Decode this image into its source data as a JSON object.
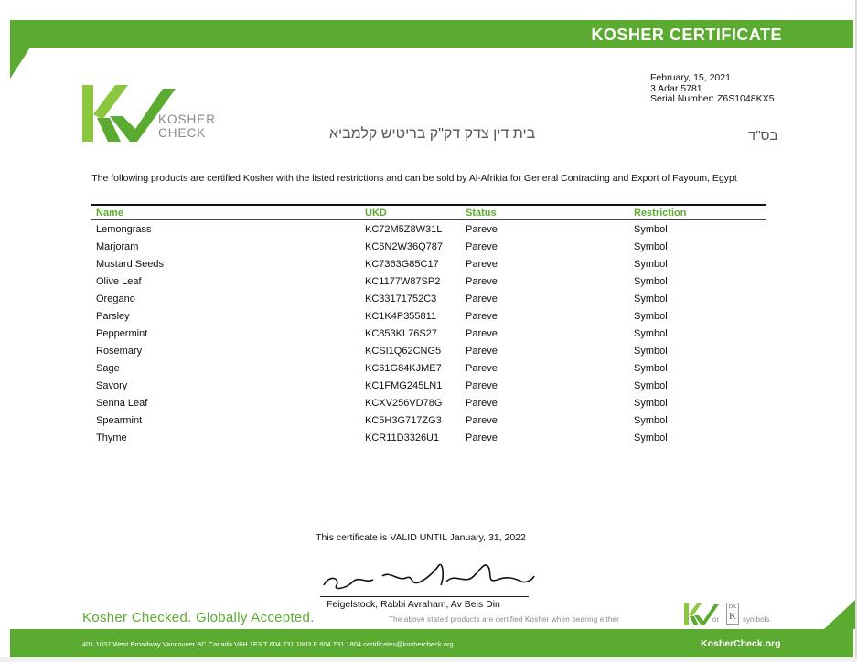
{
  "certificate": {
    "header_title": "KOSHER CERTIFICATE",
    "logo_word_1": "KOSHER",
    "logo_word_2": "CHECK",
    "hebrew_court": "בית דין צדק דק\"ק בריטיש קלמביא",
    "hebrew_bsd": "בס\"ד",
    "date": "February, 15, 2021",
    "hebrew_date": "3 Adar 5781",
    "serial_label": "Serial Number:",
    "serial_number": "Z6S1048KX5",
    "intro": "The following products are certified Kosher with the listed restrictions and can be sold by Al-Afrikia for General Contracting and Export of Fayoum, Egypt",
    "valid_until": "This certificate is VALID UNTIL January, 31, 2022",
    "signature": "אברהם פייגעלשטאק",
    "signer": "Feigelstock, Rabbi Avraham, Av Beis Din"
  },
  "table": {
    "headers": {
      "name": "Name",
      "ukd": "UKD",
      "status": "Status",
      "restriction": "Restriction"
    },
    "rows": [
      {
        "name": "Lemongrass",
        "ukd": "KC72M5Z8W31L",
        "status": "Pareve",
        "restriction": "Symbol"
      },
      {
        "name": "Marjoram",
        "ukd": "KC6N2W36Q787",
        "status": "Pareve",
        "restriction": "Symbol"
      },
      {
        "name": "Mustard Seeds",
        "ukd": "KC7363G85C17",
        "status": "Pareve",
        "restriction": "Symbol"
      },
      {
        "name": "Olive Leaf",
        "ukd": "KC1177W87SP2",
        "status": "Pareve",
        "restriction": "Symbol"
      },
      {
        "name": "Oregano",
        "ukd": "KC33171752C3",
        "status": "Pareve",
        "restriction": "Symbol"
      },
      {
        "name": "Parsley",
        "ukd": "KC1K4P355811",
        "status": "Pareve",
        "restriction": "Symbol"
      },
      {
        "name": "Peppermint",
        "ukd": "KC853KL76S27",
        "status": "Pareve",
        "restriction": "Symbol"
      },
      {
        "name": "Rosemary",
        "ukd": "KCSI1Q62CNG5",
        "status": "Pareve",
        "restriction": "Symbol"
      },
      {
        "name": "Sage",
        "ukd": "KC61G84KJME7",
        "status": "Pareve",
        "restriction": "Symbol"
      },
      {
        "name": "Savory",
        "ukd": "KC1FMG245LN1",
        "status": "Pareve",
        "restriction": "Symbol"
      },
      {
        "name": "Senna Leaf",
        "ukd": "KCXV256VD78G",
        "status": "Pareve",
        "restriction": "Symbol"
      },
      {
        "name": "Spearmint",
        "ukd": "KC5H3G717ZG3",
        "status": "Pareve",
        "restriction": "Symbol"
      },
      {
        "name": "Thyme",
        "ukd": "KCR11D3326U1",
        "status": "Pareve",
        "restriction": "Symbol"
      }
    ]
  },
  "footer": {
    "tagline": "Kosher Checked. Globally Accepted.",
    "fine_print": "The above stated products are certified Kosher when bearing either",
    "or_text": "or",
    "dk_top": "DK",
    "dk_letter": "K",
    "symbols_text": "symbols.",
    "contact": "401.1037 West Broadway  Vancouver BC  Canada V6H 1E3  T 604.731.1803  F 604.731.1804  certificates@koshercheck.org",
    "website": "KosherCheck.org"
  },
  "colors": {
    "brand_green": "#5bab30",
    "logo_light_green": "#8dc63f",
    "logo_dark_green": "#5bab30"
  },
  "icons": [
    "koshercheck-logo-icon",
    "koshercheck-small-logo-icon",
    "dk-symbol-icon"
  ]
}
